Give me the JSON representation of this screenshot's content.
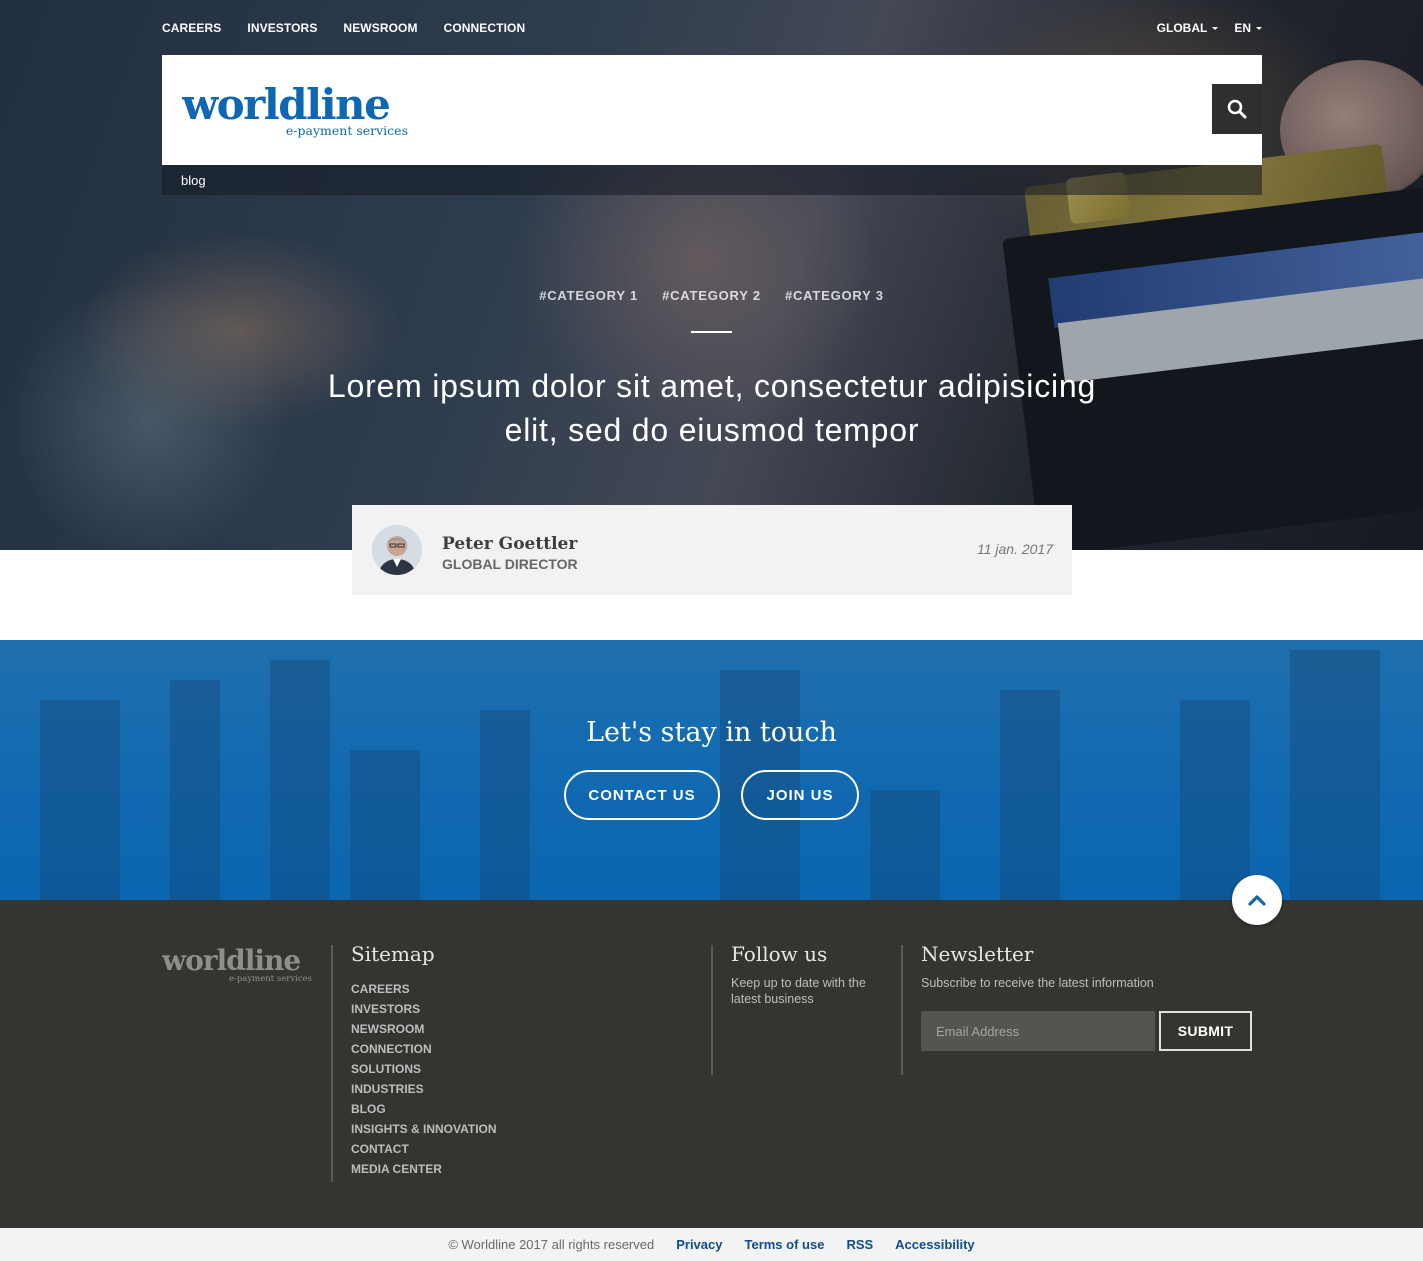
{
  "colors": {
    "brand_blue": "#0e67b2",
    "footer_bg": "#343431",
    "author_card_bg": "#f2f2f2",
    "link_blue": "#0e4d8f"
  },
  "top_nav": {
    "links": [
      "CAREERS",
      "INVESTORS",
      "NEWSROOM",
      "CONNECTION"
    ],
    "region": "GLOBAL",
    "language": "EN"
  },
  "header": {
    "logo_word": "worldline",
    "logo_tagline": "e-payment services",
    "search_icon": "search-icon",
    "breadcrumb": "blog"
  },
  "article": {
    "categories": [
      "#CATEGORY 1",
      "#CATEGORY 2",
      "#CATEGORY 3"
    ],
    "title": "Lorem ipsum dolor sit amet, consectetur adipisicing elit, sed do eiusmod tempor",
    "author": {
      "name": "Peter Goettler",
      "role": "GLOBAL DIRECTOR",
      "date": "11 jan. 2017"
    }
  },
  "touch": {
    "title": "Let's stay in touch",
    "contact_label": "CONTACT US",
    "join_label": "JOIN US",
    "scroll_icon": "chevron-up-icon"
  },
  "footer": {
    "logo_word": "worldline",
    "logo_tagline": "e-payment services",
    "sitemap": {
      "heading": "Sitemap",
      "items": [
        "CAREERS",
        "INVESTORS",
        "NEWSROOM",
        "CONNECTION",
        "SOLUTIONS",
        "INDUSTRIES",
        "BLOG",
        "INSIGHTS & INNOVATION",
        "CONTACT",
        "MEDIA CENTER"
      ]
    },
    "follow": {
      "heading": "Follow us",
      "text": "Keep up to date with the latest business"
    },
    "newsletter": {
      "heading": "Newsletter",
      "text": "Subscribe to receive the latest information",
      "email_placeholder": "Email Address",
      "email_value": "",
      "submit_label": "SUBMIT"
    }
  },
  "bottom_bar": {
    "copyright": "© Worldline 2017 all rights reserved",
    "links": [
      "Privacy",
      "Terms of use",
      "RSS",
      "Accessibility"
    ]
  }
}
